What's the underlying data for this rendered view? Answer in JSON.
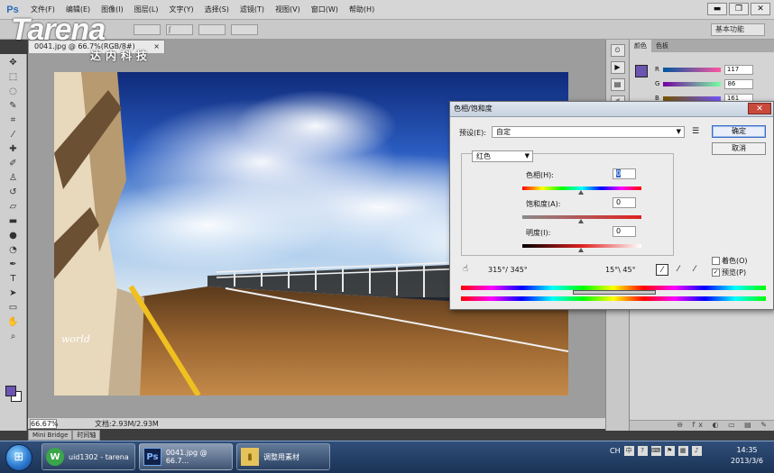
{
  "app": {
    "logo": "Ps",
    "menus": [
      "文件(F)",
      "编辑(E)",
      "图像(I)",
      "图层(L)",
      "文字(Y)",
      "选择(S)",
      "滤镜(T)",
      "视图(V)",
      "窗口(W)",
      "帮助(H)"
    ],
    "window_buttons": [
      "▬",
      "❐",
      "✕"
    ],
    "workspace": "基本功能",
    "options": [
      "",
      "ʃ",
      "",
      ""
    ]
  },
  "watermark": {
    "brand": "Tarena",
    "sub": "达内科技"
  },
  "document": {
    "tab_title": "0041.jpg @ 66.7%(RGB/8#)",
    "tab_close": "×",
    "canvas_watermark": "world",
    "zoom": "66.67%",
    "doc_info": "文档:2.93M/2.93M"
  },
  "bridge_tabs": [
    "Mini Bridge",
    "时间轴"
  ],
  "color_panel": {
    "tabs": [
      "颜色",
      "色板"
    ],
    "rows": [
      {
        "label": "R",
        "value": "117"
      },
      {
        "label": "G",
        "value": "86"
      },
      {
        "label": "B",
        "value": "161"
      }
    ],
    "colors": {
      "foreground": "#6b55b0"
    },
    "bottom_icons": "⊖ fx ◐ ▭ ▤ ✎"
  },
  "hue_dialog": {
    "title": "色相/饱和度",
    "close": "✕",
    "preset_label": "预设(E):",
    "preset_value": "自定",
    "ok": "确定",
    "cancel": "取消",
    "channel": "红色",
    "params": [
      {
        "label": "色相(H):",
        "value": "0"
      },
      {
        "label": "饱和度(A):",
        "value": "0"
      },
      {
        "label": "明度(I):",
        "value": "0"
      }
    ],
    "colorize": "着色(O)",
    "preview": "预览(P)",
    "preview_checked": "✓",
    "range_left": "315°/ 345°",
    "range_right": "15°\\ 45°"
  },
  "taskbar": {
    "buttons": [
      {
        "icon": "W",
        "label": "uid1302 - tarena"
      },
      {
        "icon": "Ps",
        "label": "0041.jpg @ 66.7..."
      },
      {
        "icon": "▮",
        "label": "调整用素材"
      }
    ],
    "tray_lang": "CH",
    "time": "14:35",
    "date": "2013/3/6"
  }
}
